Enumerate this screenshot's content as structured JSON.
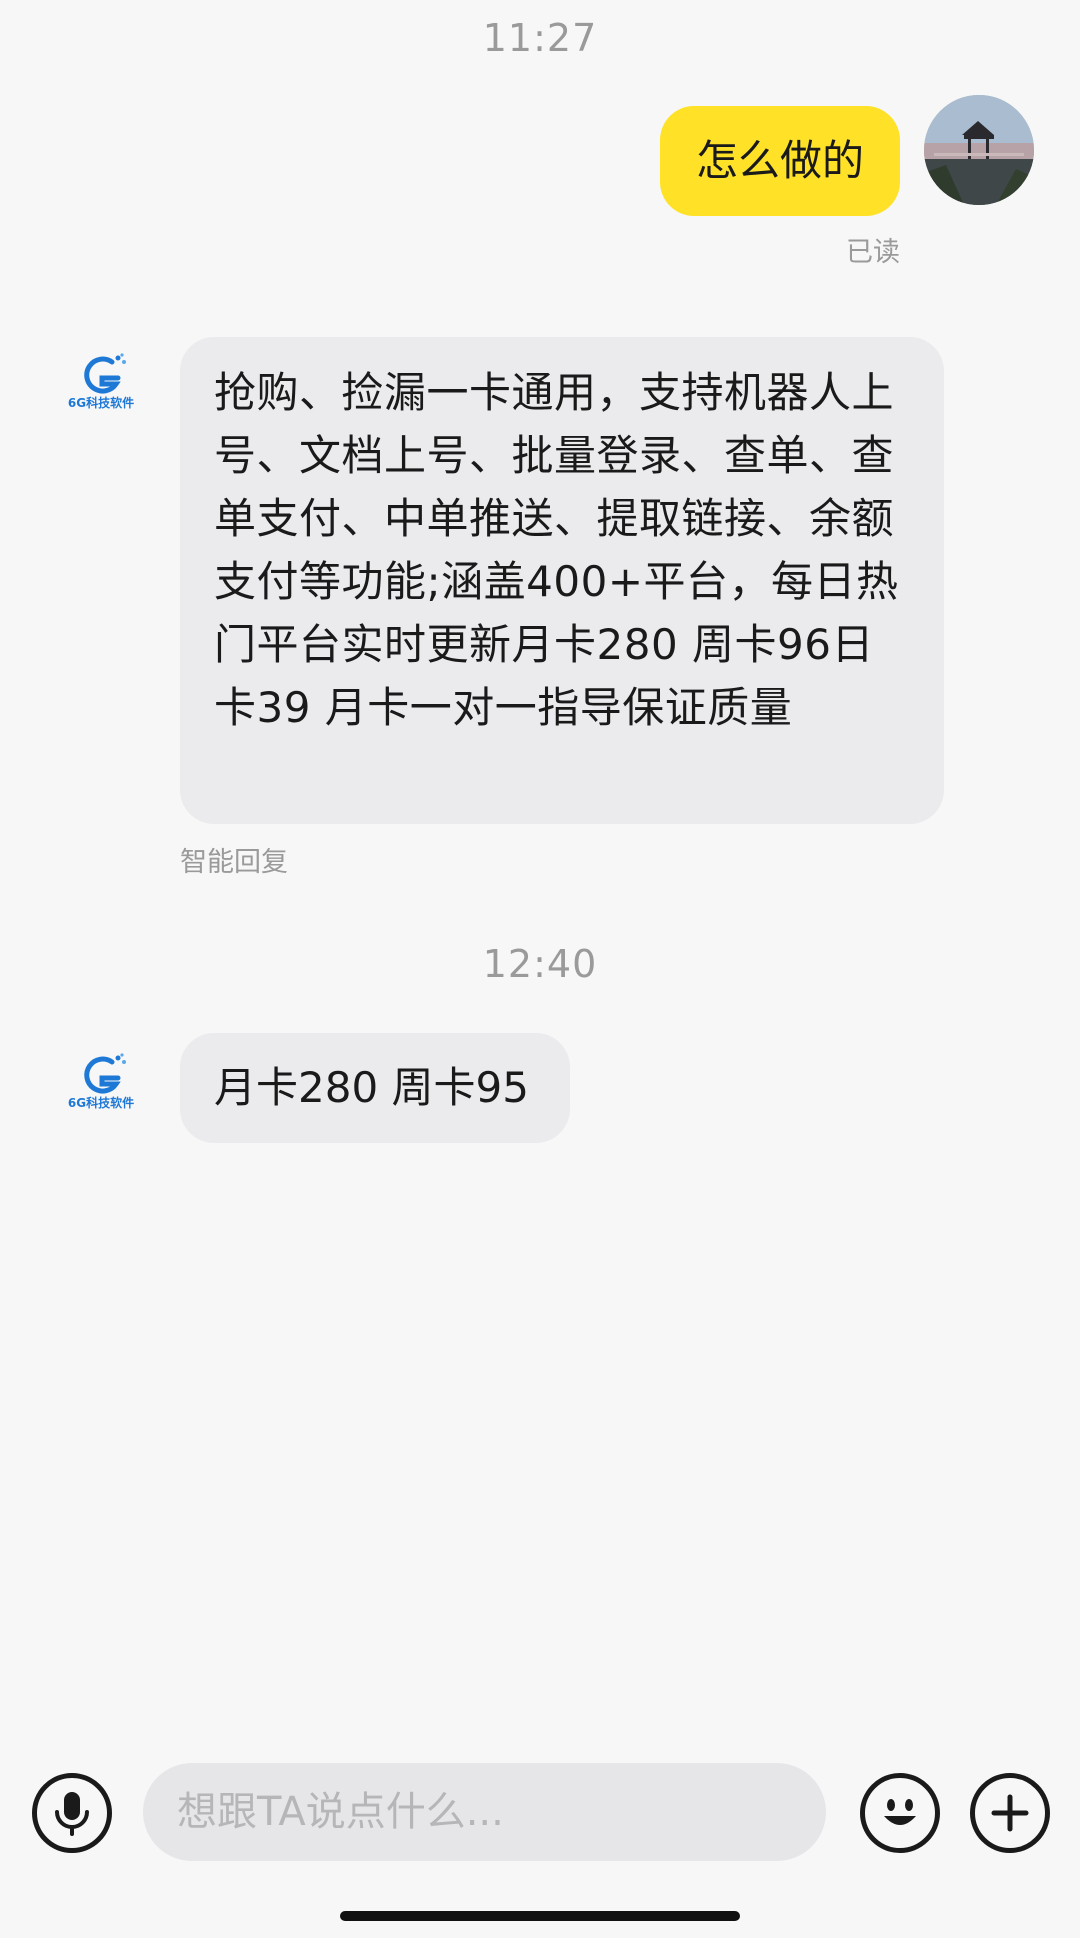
{
  "conversation": {
    "timestamps": [
      "11:27",
      "12:40"
    ],
    "outgoing": {
      "text": "怎么做的",
      "read_status": "已读"
    },
    "incoming": [
      {
        "text": "抢购、捡漏一卡通用，支持机器人上号、文档上号、批量登录、查单、查单支付、中单推送、提取链接、余额支付等功能;涵盖400+平台，每日热门平台实时更新月卡280 周卡96日卡39 月卡一对一指导保证质量",
        "footer": "智能回复"
      },
      {
        "text": "月卡280 周卡95"
      }
    ],
    "bot_avatar": {
      "logo_text": "6G科技软件",
      "accent": "#1e78d6"
    }
  },
  "input_bar": {
    "placeholder": "想跟TA说点什么...",
    "value": "",
    "icons": [
      "microphone-icon",
      "emoji-icon",
      "plus-icon"
    ]
  },
  "colors": {
    "outgoing_bubble": "#ffe227",
    "incoming_bubble": "#ebebed",
    "background": "#f7f7f7",
    "meta_text": "#9a9a9a"
  }
}
